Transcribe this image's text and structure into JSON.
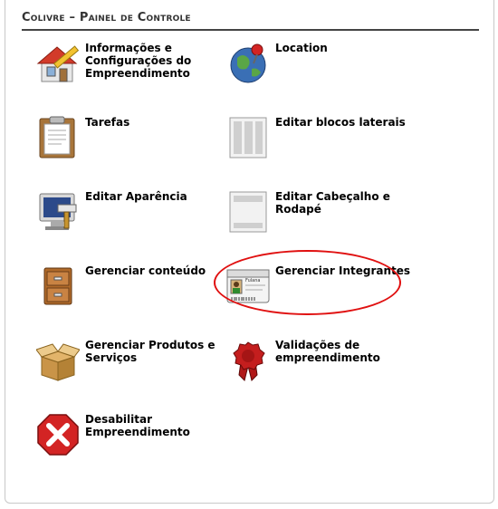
{
  "panel": {
    "title": "Colivre – Painel de Controle"
  },
  "items": [
    {
      "label": "Informações e Configurações do Empreendimento",
      "icon": "house-edit-icon"
    },
    {
      "label": "Location",
      "icon": "globe-pin-icon"
    },
    {
      "label": "Tarefas",
      "icon": "clipboard-icon"
    },
    {
      "label": "Editar blocos laterais",
      "icon": "side-blocks-icon"
    },
    {
      "label": "Editar Aparência",
      "icon": "monitor-paint-icon"
    },
    {
      "label": "Editar Cabeçalho e Rodapé",
      "icon": "header-footer-icon"
    },
    {
      "label": "Gerenciar conteúdo",
      "icon": "cabinet-icon"
    },
    {
      "label": "Gerenciar Integrantes",
      "icon": "id-card-icon",
      "card_name": "Fulana"
    },
    {
      "label": "Gerenciar Produtos e Serviços",
      "icon": "open-box-icon"
    },
    {
      "label": "Validações de empreendimento",
      "icon": "seal-icon"
    },
    {
      "label": "Desabilitar Empreendimento",
      "icon": "disable-x-icon"
    }
  ],
  "colors": {
    "highlight": "#e01010",
    "disable": "#d32424"
  }
}
